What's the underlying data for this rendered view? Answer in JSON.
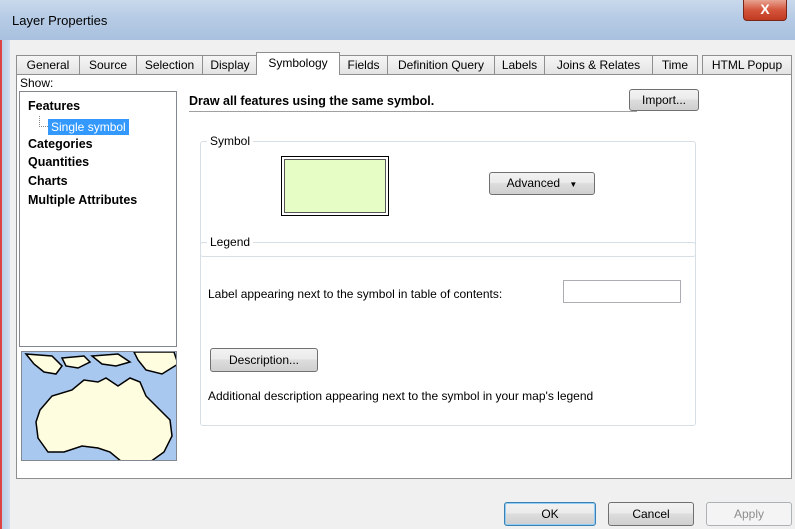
{
  "window": {
    "title": "Layer Properties",
    "close_label": "X"
  },
  "tabs": [
    {
      "label": "General"
    },
    {
      "label": "Source"
    },
    {
      "label": "Selection"
    },
    {
      "label": "Display"
    },
    {
      "label": "Symbology",
      "active": true
    },
    {
      "label": "Fields"
    },
    {
      "label": "Definition Query"
    },
    {
      "label": "Labels"
    },
    {
      "label": "Joins & Relates"
    },
    {
      "label": "Time"
    },
    {
      "label": "HTML Popup"
    }
  ],
  "show": {
    "label": "Show:",
    "items": [
      "Features",
      "Categories",
      "Quantities",
      "Charts",
      "Multiple Attributes"
    ],
    "selected_sub": "Single symbol"
  },
  "content": {
    "description": "Draw all features using the same symbol.",
    "import_label": "Import...",
    "symbol_group": "Symbol",
    "symbol_fill_color": "#e6fec6",
    "advanced_label": "Advanced",
    "legend_group": "Legend",
    "label_prompt": "Label appearing next to the symbol in table of contents:",
    "label_value": "",
    "description_button": "Description...",
    "additional_text": "Additional description appearing next to the symbol in your map's legend"
  },
  "footer": {
    "ok": "OK",
    "cancel": "Cancel",
    "apply": "Apply"
  }
}
